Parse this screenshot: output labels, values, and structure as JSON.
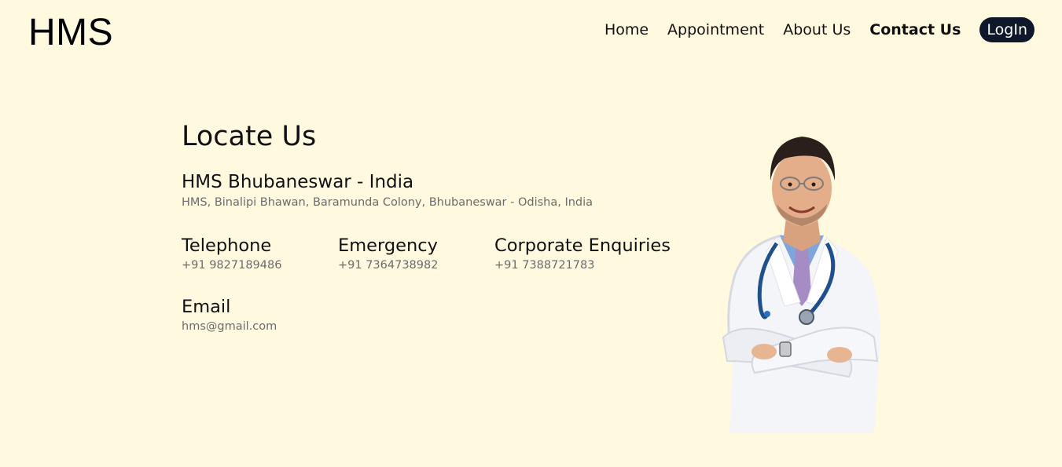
{
  "brand": "HMS",
  "nav": {
    "home": "Home",
    "appointment": "Appointment",
    "about": "About Us",
    "contact": "Contact Us",
    "login": "LogIn"
  },
  "main": {
    "title": "Locate Us",
    "branch_name": "HMS Bhubaneswar - India",
    "address": "HMS, Binalipi Bhawan, Baramunda Colony, Bhubaneswar - Odisha, India",
    "contacts": [
      {
        "label": "Telephone",
        "value": "+91 9827189486"
      },
      {
        "label": "Emergency",
        "value": "+91 7364738982"
      },
      {
        "label": "Corporate Enquiries",
        "value": "+91 7388721783"
      }
    ],
    "email_label": "Email",
    "email_value": "hms@gmail.com"
  },
  "colors": {
    "background": "#fff9df",
    "login_button": "#0f172a",
    "muted_text": "#6b6b6b"
  },
  "illustration": "doctor-image"
}
